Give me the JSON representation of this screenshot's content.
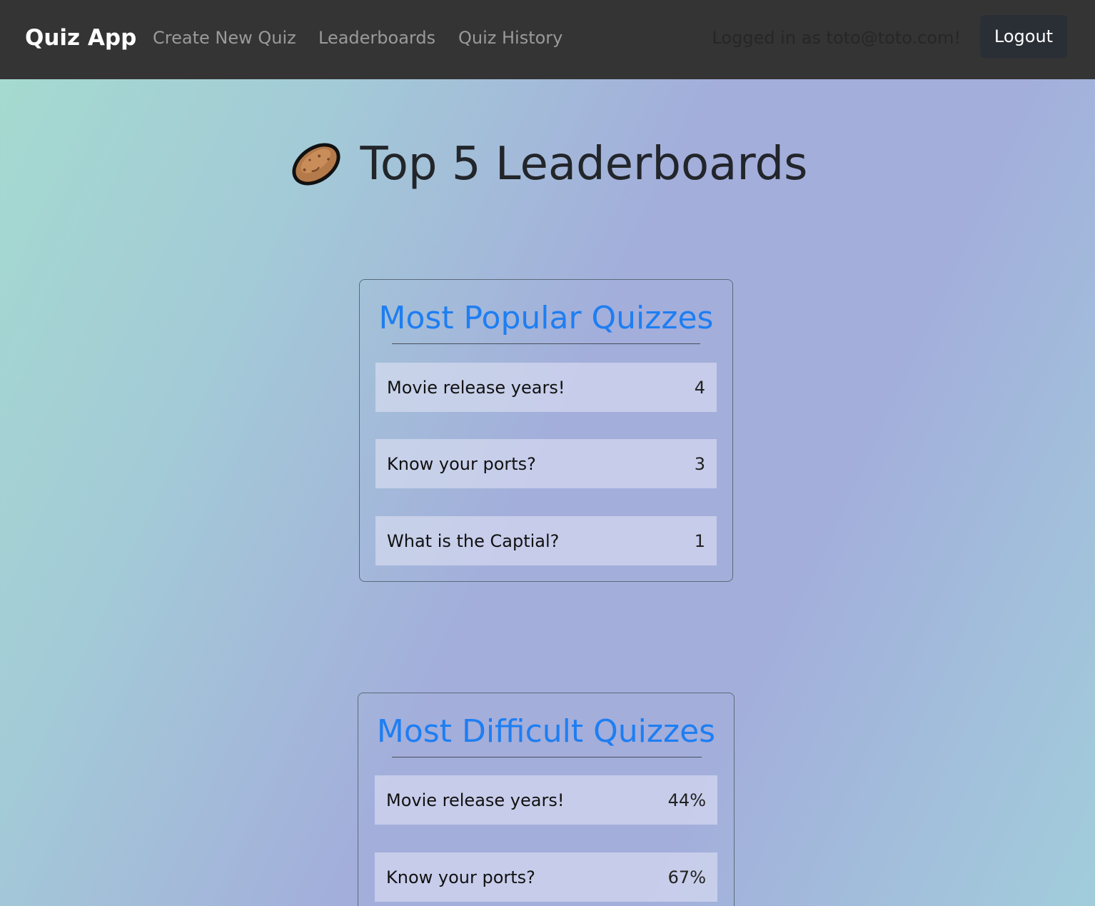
{
  "navbar": {
    "brand": "Quiz App",
    "links": [
      "Create New Quiz",
      "Leaderboards",
      "Quiz History"
    ],
    "logged_in_text": "Logged in as toto@toto.com!",
    "logout_label": "Logout"
  },
  "page": {
    "title": "Top 5 Leaderboards",
    "title_icon": "potato-icon"
  },
  "popular": {
    "title": "Most Popular Quizzes",
    "items": [
      {
        "name": "Movie release years!",
        "value": "4"
      },
      {
        "name": "Know your ports?",
        "value": "3"
      },
      {
        "name": "What is the Captial?",
        "value": "1"
      }
    ]
  },
  "difficult": {
    "title": "Most Difficult Quizzes",
    "items": [
      {
        "name": "Movie release years!",
        "value": "44%"
      },
      {
        "name": "Know your ports?",
        "value": "67%"
      }
    ]
  },
  "colors": {
    "navbar_bg": "#343434",
    "accent": "#1e7ef2",
    "logout_bg": "#2a2f36"
  }
}
